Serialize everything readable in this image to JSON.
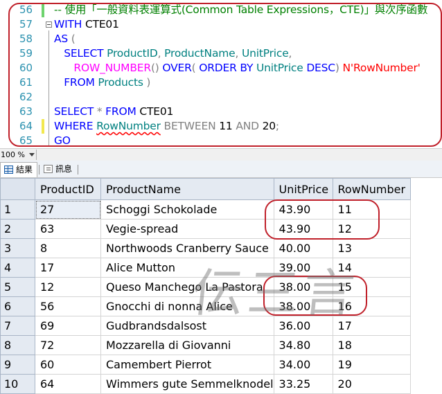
{
  "editor": {
    "lines": [
      {
        "num": "56",
        "change": "green",
        "tokens": [
          {
            "c": "cm",
            "t": "-- 使用「一般資料表運算式(Common Table Expressions，CTE)」與次序函數"
          }
        ]
      },
      {
        "num": "57",
        "change": "",
        "tokens": [
          {
            "c": "kw",
            "t": "WITH "
          },
          {
            "c": "tx",
            "t": "CTE01"
          }
        ]
      },
      {
        "num": "58",
        "change": "",
        "tokens": [
          {
            "c": "kw",
            "t": "AS "
          },
          {
            "c": "op",
            "t": "("
          }
        ]
      },
      {
        "num": "59",
        "change": "",
        "tokens": [
          {
            "c": "tx",
            "t": "   "
          },
          {
            "c": "kw",
            "t": "SELECT "
          },
          {
            "c": "ob",
            "t": "ProductID"
          },
          {
            "c": "op",
            "t": ", "
          },
          {
            "c": "ob",
            "t": "ProductName"
          },
          {
            "c": "op",
            "t": ", "
          },
          {
            "c": "ob",
            "t": "UnitPrice"
          },
          {
            "c": "op",
            "t": ","
          }
        ]
      },
      {
        "num": "60",
        "change": "",
        "tokens": [
          {
            "c": "tx",
            "t": "      "
          },
          {
            "c": "fn",
            "t": "ROW_NUMBER"
          },
          {
            "c": "op",
            "t": "() "
          },
          {
            "c": "kw",
            "t": "OVER"
          },
          {
            "c": "op",
            "t": "( "
          },
          {
            "c": "kw",
            "t": "ORDER BY "
          },
          {
            "c": "ob",
            "t": "UnitPrice "
          },
          {
            "c": "kw",
            "t": "DESC"
          },
          {
            "c": "op",
            "t": ") "
          },
          {
            "c": "st",
            "t": "N'RowNumber'"
          }
        ]
      },
      {
        "num": "61",
        "change": "",
        "tokens": [
          {
            "c": "tx",
            "t": "   "
          },
          {
            "c": "kw",
            "t": "FROM "
          },
          {
            "c": "ob",
            "t": "Products"
          },
          {
            "c": "op",
            "t": " )"
          }
        ]
      },
      {
        "num": "62",
        "change": "",
        "tokens": []
      },
      {
        "num": "63",
        "change": "",
        "tokens": [
          {
            "c": "kw",
            "t": "SELECT "
          },
          {
            "c": "op",
            "t": "* "
          },
          {
            "c": "kw",
            "t": "FROM "
          },
          {
            "c": "tx",
            "t": "CTE01"
          }
        ]
      },
      {
        "num": "64",
        "change": "yellow",
        "tokens": [
          {
            "c": "kw",
            "t": "WHERE "
          },
          {
            "c": "ob squig",
            "t": "RowNumber"
          },
          {
            "c": "op",
            "t": " BETWEEN "
          },
          {
            "c": "tx",
            "t": "11 "
          },
          {
            "c": "op",
            "t": "AND "
          },
          {
            "c": "tx",
            "t": "20"
          },
          {
            "c": "op",
            "t": ";"
          }
        ]
      },
      {
        "num": "65",
        "change": "",
        "tokens": [
          {
            "c": "kw",
            "t": "GO"
          }
        ]
      }
    ]
  },
  "zoom": {
    "value": "100 %"
  },
  "tabs": [
    {
      "label": "結果",
      "icon": "grid-icon"
    },
    {
      "label": "訊息",
      "icon": "message-icon"
    }
  ],
  "grid": {
    "columns": [
      "ProductID",
      "ProductName",
      "UnitPrice",
      "RowNumber"
    ],
    "rows": [
      {
        "n": "1",
        "cells": [
          "27",
          "Schoggi Schokolade",
          "43.90",
          "11"
        ]
      },
      {
        "n": "2",
        "cells": [
          "63",
          "Vegie-spread",
          "43.90",
          "12"
        ]
      },
      {
        "n": "3",
        "cells": [
          "8",
          "Northwoods Cranberry Sauce",
          "40.00",
          "13"
        ]
      },
      {
        "n": "4",
        "cells": [
          "17",
          "Alice Mutton",
          "39.00",
          "14"
        ]
      },
      {
        "n": "5",
        "cells": [
          "12",
          "Queso Manchego La Pastora",
          "38.00",
          "15"
        ]
      },
      {
        "n": "6",
        "cells": [
          "56",
          "Gnocchi di nonna Alice",
          "38.00",
          "16"
        ]
      },
      {
        "n": "7",
        "cells": [
          "69",
          "Gudbrandsdalsost",
          "36.00",
          "17"
        ]
      },
      {
        "n": "8",
        "cells": [
          "72",
          "Mozzarella di Giovanni",
          "34.80",
          "18"
        ]
      },
      {
        "n": "9",
        "cells": [
          "60",
          "Camembert Pierrot",
          "34.00",
          "19"
        ]
      },
      {
        "n": "10",
        "cells": [
          "64",
          "Wimmers gute Semmelknodel",
          "33.25",
          "20"
        ]
      }
    ]
  },
  "watermark": "伝三言",
  "colors": {
    "annotation": "#c0202a",
    "keyword": "#0000ff",
    "identifier": "#008080",
    "comment": "#008000"
  }
}
